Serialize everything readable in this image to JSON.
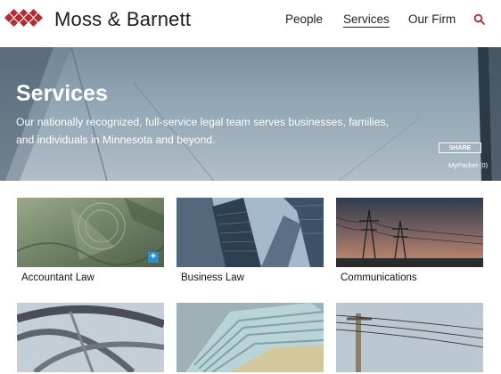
{
  "brand": {
    "name": "Moss & Barnett",
    "logo_color": "#b52b32"
  },
  "nav": {
    "items": [
      {
        "label": "People",
        "active": false
      },
      {
        "label": "Services",
        "active": true
      },
      {
        "label": "Our Firm",
        "active": false
      }
    ],
    "search_icon": "search-icon"
  },
  "hero": {
    "title": "Services",
    "description": "Our nationally recognized, full-service legal team serves businesses, families, and individuals in Minnesota and beyond.",
    "share_label": "SHARE",
    "mypacket_label": "MyPacket (0)"
  },
  "cards": [
    {
      "label": "Accountant Law",
      "has_plus": true
    },
    {
      "label": "Business Law"
    },
    {
      "label": "Communications"
    },
    {
      "label": ""
    },
    {
      "label": ""
    },
    {
      "label": ""
    }
  ],
  "colors": {
    "accent_red": "#b52b32",
    "plus_blue": "#2a8fd4"
  }
}
